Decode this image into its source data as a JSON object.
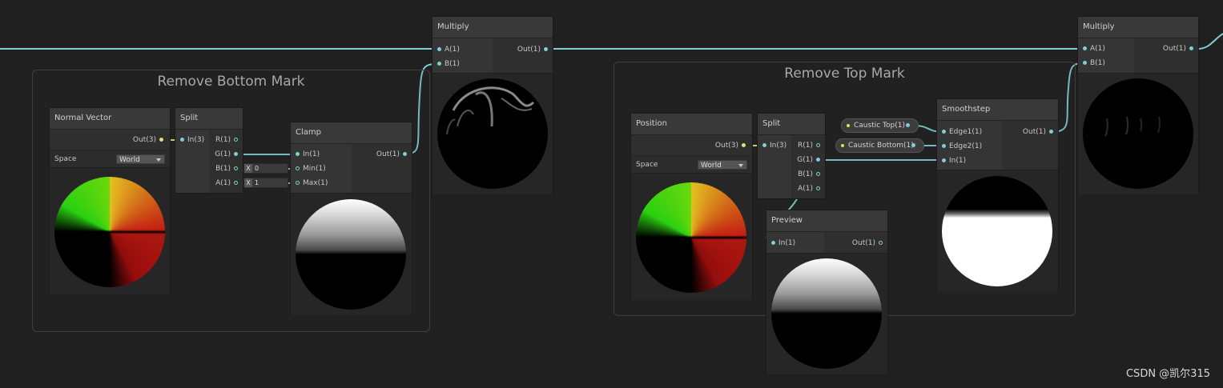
{
  "groups": [
    {
      "title": "Remove Bottom Mark"
    },
    {
      "title": "Remove Top Mark"
    }
  ],
  "nodes": {
    "normal_vector": {
      "title": "Normal Vector",
      "out": "Out(3)",
      "space_label": "Space",
      "space_value": "World"
    },
    "split1": {
      "title": "Split",
      "in": "In(3)",
      "outs": [
        "R(1)",
        "G(1)",
        "B(1)",
        "A(1)"
      ]
    },
    "clamp": {
      "title": "Clamp",
      "ins": [
        "In(1)",
        "Min(1)",
        "Max(1)"
      ],
      "out": "Out(1)",
      "min_axis": "X",
      "min_value": "0",
      "max_axis": "X",
      "max_value": "1"
    },
    "multiply1": {
      "title": "Multiply",
      "ins": [
        "A(1)",
        "B(1)"
      ],
      "out": "Out(1)"
    },
    "position": {
      "title": "Position",
      "out": "Out(3)",
      "space_label": "Space",
      "space_value": "World"
    },
    "split2": {
      "title": "Split",
      "in": "In(3)",
      "outs": [
        "R(1)",
        "G(1)",
        "B(1)",
        "A(1)"
      ]
    },
    "caustic_top": {
      "label": "Caustic Top(1)"
    },
    "caustic_bottom": {
      "label": "Caustic Bottom(1)"
    },
    "smoothstep": {
      "title": "Smoothstep",
      "ins": [
        "Edge1(1)",
        "Edge2(1)",
        "In(1)"
      ],
      "out": "Out(1)"
    },
    "preview": {
      "title": "Preview",
      "in": "In(1)",
      "out": "Out(1)"
    },
    "multiply2": {
      "title": "Multiply",
      "ins": [
        "A(1)",
        "B(1)"
      ],
      "out": "Out(1)"
    }
  },
  "colors": {
    "wire": "#7fcfd4",
    "wire_vec3": "#e0df7a",
    "background": "#202020"
  },
  "watermark": "CSDN @凯尔315"
}
